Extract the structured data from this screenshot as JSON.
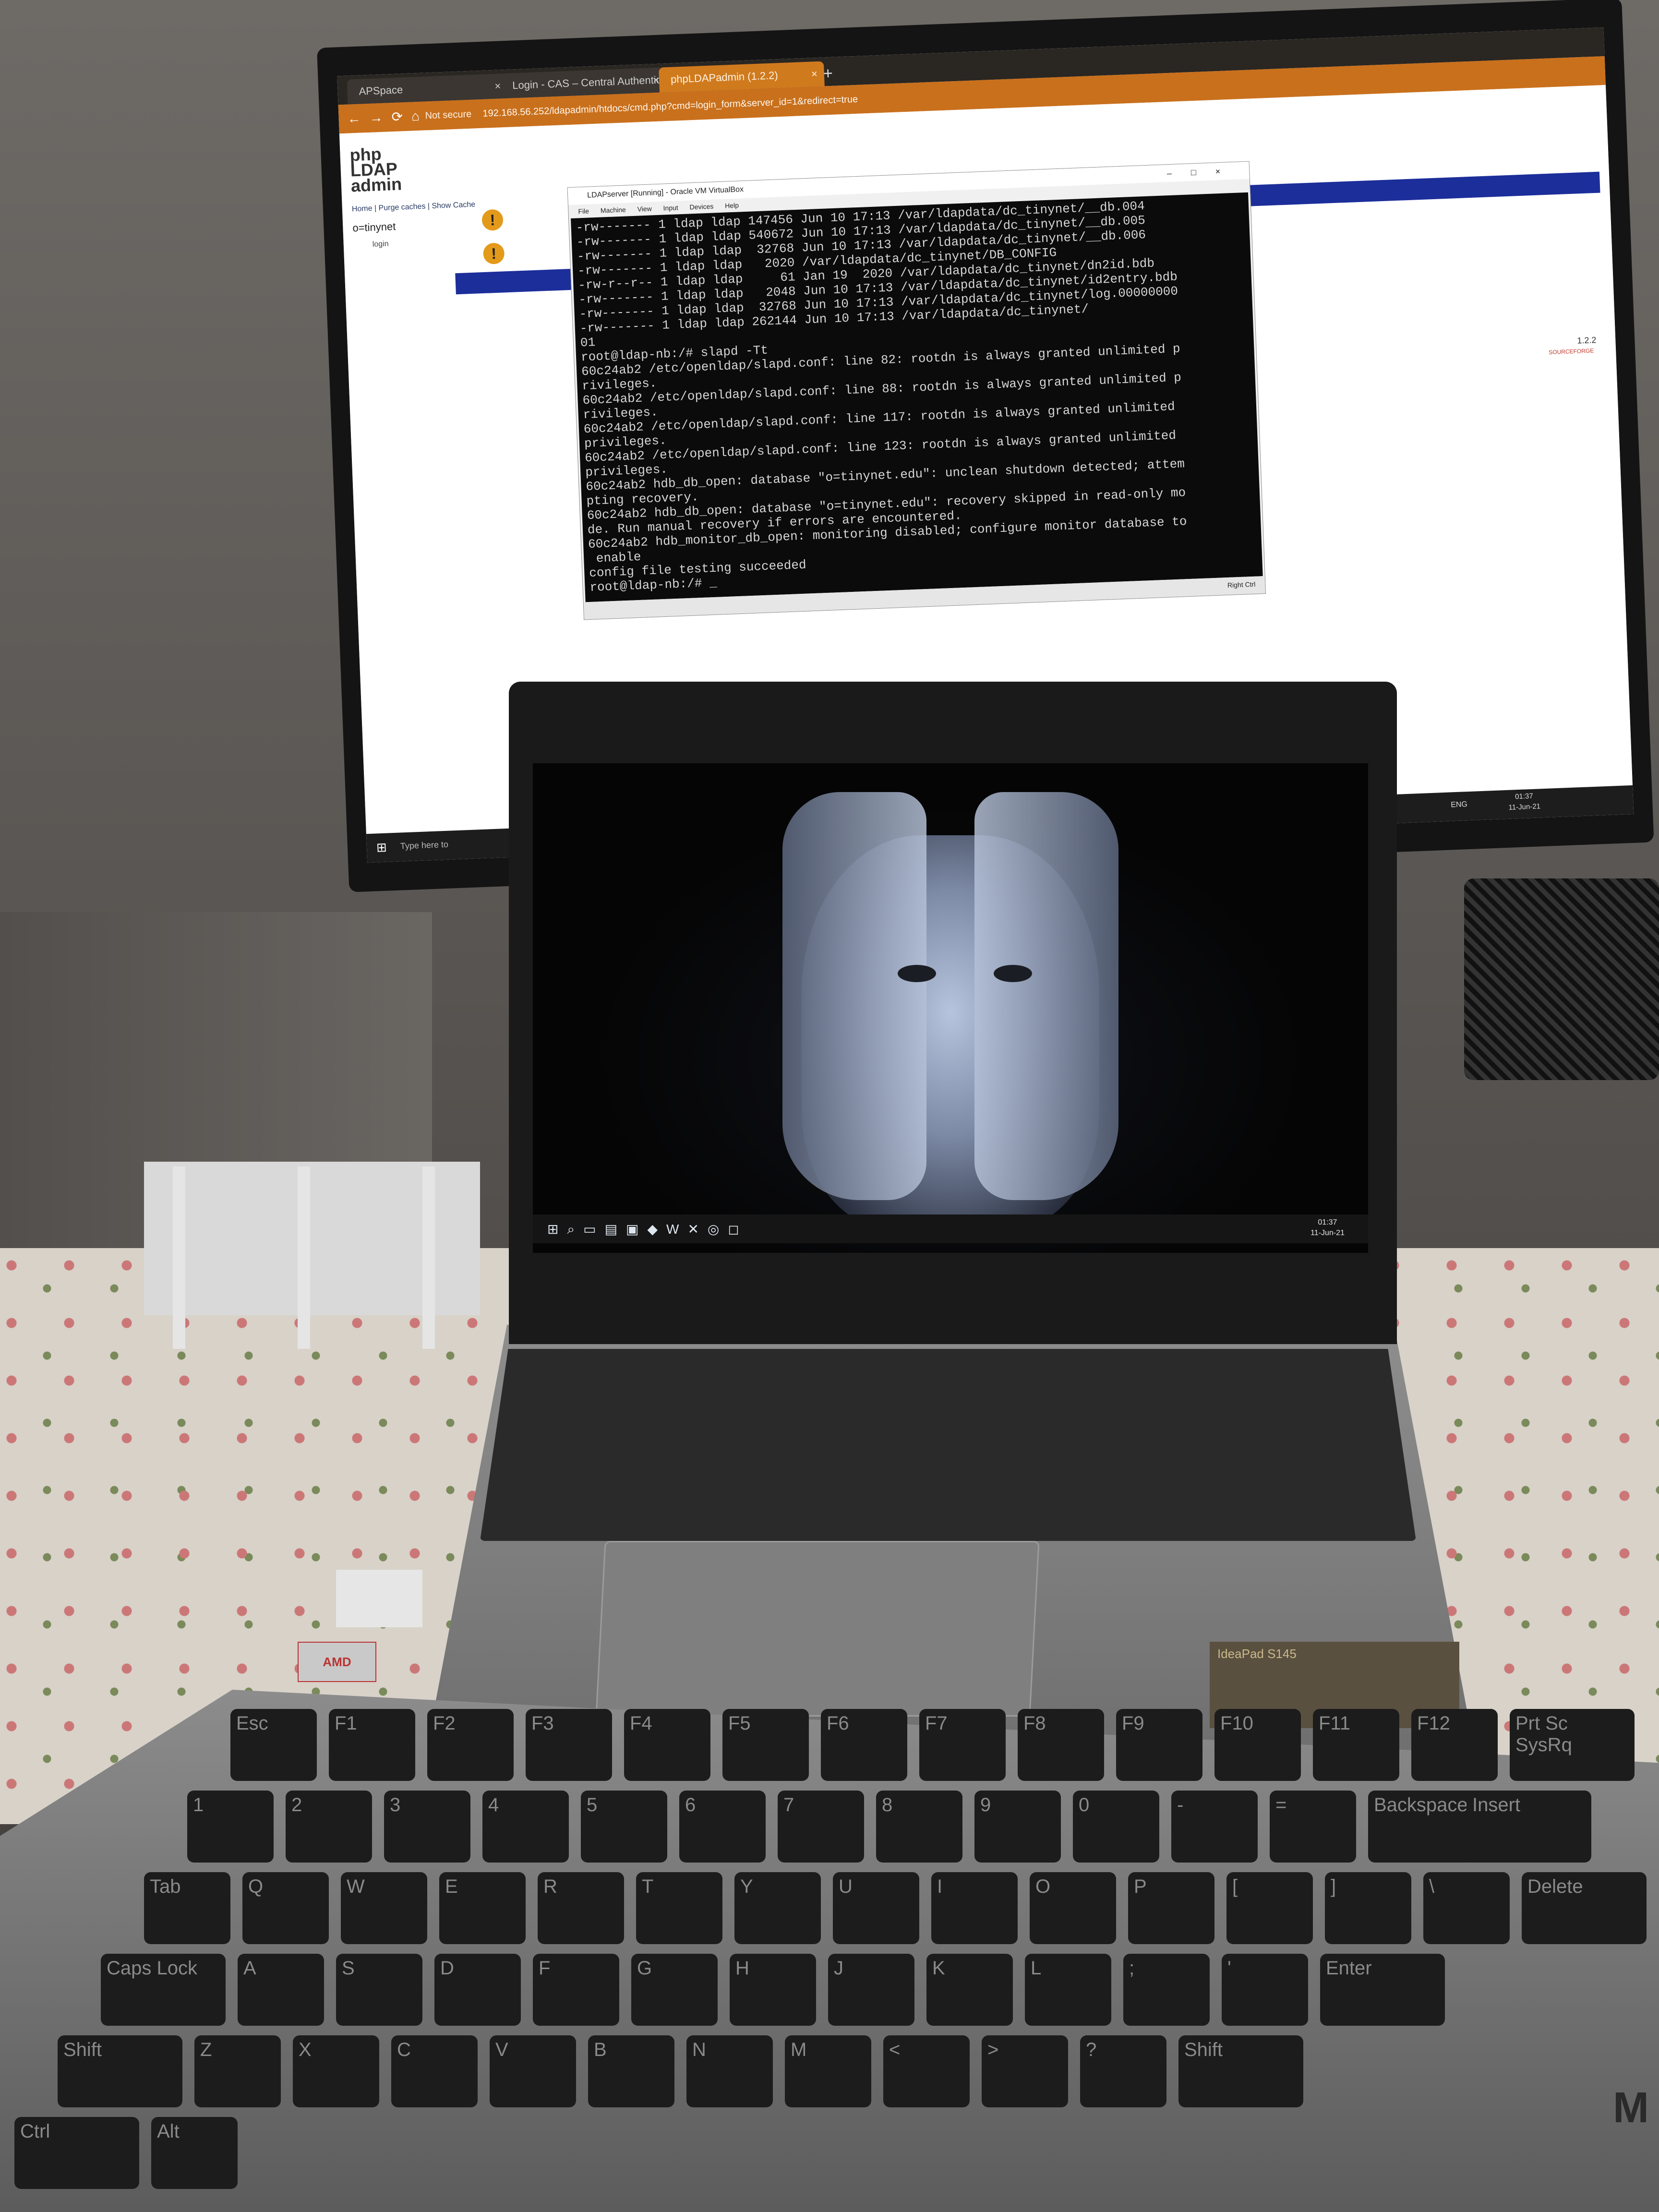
{
  "browser": {
    "tabs": [
      "APSpace",
      "Login - CAS – Central Authentic…",
      "phpLDAPadmin (1.2.2)"
    ],
    "new_tab": "+",
    "security": "Not secure",
    "url": "192.168.56.252/ldapadmin/htdocs/cmd.php?cmd=login_form&server_id=1&redirect=true"
  },
  "phpldapadmin": {
    "logo": "php LDAP admin",
    "nav": "Home | Purge caches | Show Cache",
    "tree_root": "o=tinynet",
    "tree_login": "login",
    "version": "1.2.2",
    "sourceforge": "SOURCEFORGE"
  },
  "vbox": {
    "title": "LDAPserver [Running] - Oracle VM VirtualBox",
    "menu": [
      "File",
      "Machine",
      "View",
      "Input",
      "Devices",
      "Help"
    ],
    "host_key": "Right Ctrl",
    "terminal_lines": [
      "-rw------- 1 ldap ldap 147456 Jun 10 17:13 /var/ldapdata/dc_tinynet/__db.004",
      "-rw------- 1 ldap ldap 540672 Jun 10 17:13 /var/ldapdata/dc_tinynet/__db.005",
      "-rw------- 1 ldap ldap  32768 Jun 10 17:13 /var/ldapdata/dc_tinynet/__db.006",
      "-rw------- 1 ldap ldap   2020 /var/ldapdata/dc_tinynet/DB_CONFIG",
      "-rw-r--r-- 1 ldap ldap     61 Jan 19  2020 /var/ldapdata/dc_tinynet/dn2id.bdb",
      "-rw------- 1 ldap ldap   2048 Jun 10 17:13 /var/ldapdata/dc_tinynet/id2entry.bdb",
      "-rw------- 1 ldap ldap  32768 Jun 10 17:13 /var/ldapdata/dc_tinynet/log.00000000",
      "-rw------- 1 ldap ldap 262144 Jun 10 17:13 /var/ldapdata/dc_tinynet/",
      "01",
      "root@ldap-nb:/# slapd -Tt",
      "60c24ab2 /etc/openldap/slapd.conf: line 82: rootdn is always granted unlimited p",
      "rivileges.",
      "60c24ab2 /etc/openldap/slapd.conf: line 88: rootdn is always granted unlimited p",
      "rivileges.",
      "60c24ab2 /etc/openldap/slapd.conf: line 117: rootdn is always granted unlimited",
      "privileges.",
      "60c24ab2 /etc/openldap/slapd.conf: line 123: rootdn is always granted unlimited",
      "privileges.",
      "60c24ab2 hdb_db_open: database \"o=tinynet.edu\": unclean shutdown detected; attem",
      "pting recovery.",
      "60c24ab2 hdb_db_open: database \"o=tinynet.edu\": recovery skipped in read-only mo",
      "de. Run manual recovery if errors are encountered.",
      "60c24ab2 hdb_monitor_db_open: monitoring disabled; configure monitor database to",
      " enable",
      "config file testing succeeded",
      "root@ldap-nb:/# _"
    ]
  },
  "monitor_taskbar": {
    "search": "Type here to",
    "lang": "ENG",
    "time": "01:37",
    "date": "11-Jun-21"
  },
  "laptop": {
    "time": "01:37",
    "date": "11-Jun-21",
    "model": "IdeaPad S145",
    "sticker": "AMD"
  },
  "keyboard": {
    "row1": [
      "Esc",
      "F1",
      "F2",
      "F3",
      "F4",
      "F5",
      "F6",
      "F7",
      "F8",
      "F9",
      "F10",
      "F11",
      "F12",
      "Prt Sc SysRq"
    ],
    "row2": [
      "1",
      "2",
      "3",
      "4",
      "5",
      "6",
      "7",
      "8",
      "9",
      "0",
      "-",
      "=",
      "Backspace",
      "Insert"
    ],
    "row3": [
      "Tab",
      "Q",
      "W",
      "E",
      "R",
      "T",
      "Y",
      "U",
      "I",
      "O",
      "P",
      "[",
      "]",
      "\\",
      "Delete"
    ],
    "row4": [
      "Caps Lock",
      "A",
      "S",
      "D",
      "F",
      "G",
      "H",
      "J",
      "K",
      "L",
      ";",
      "'",
      "Enter"
    ],
    "row5": [
      "Shift",
      "Z",
      "X",
      "C",
      "V",
      "B",
      "N",
      "M",
      "<",
      ">",
      "?",
      "Shift"
    ],
    "row6": [
      "Ctrl",
      "Alt"
    ],
    "brand": "M"
  }
}
